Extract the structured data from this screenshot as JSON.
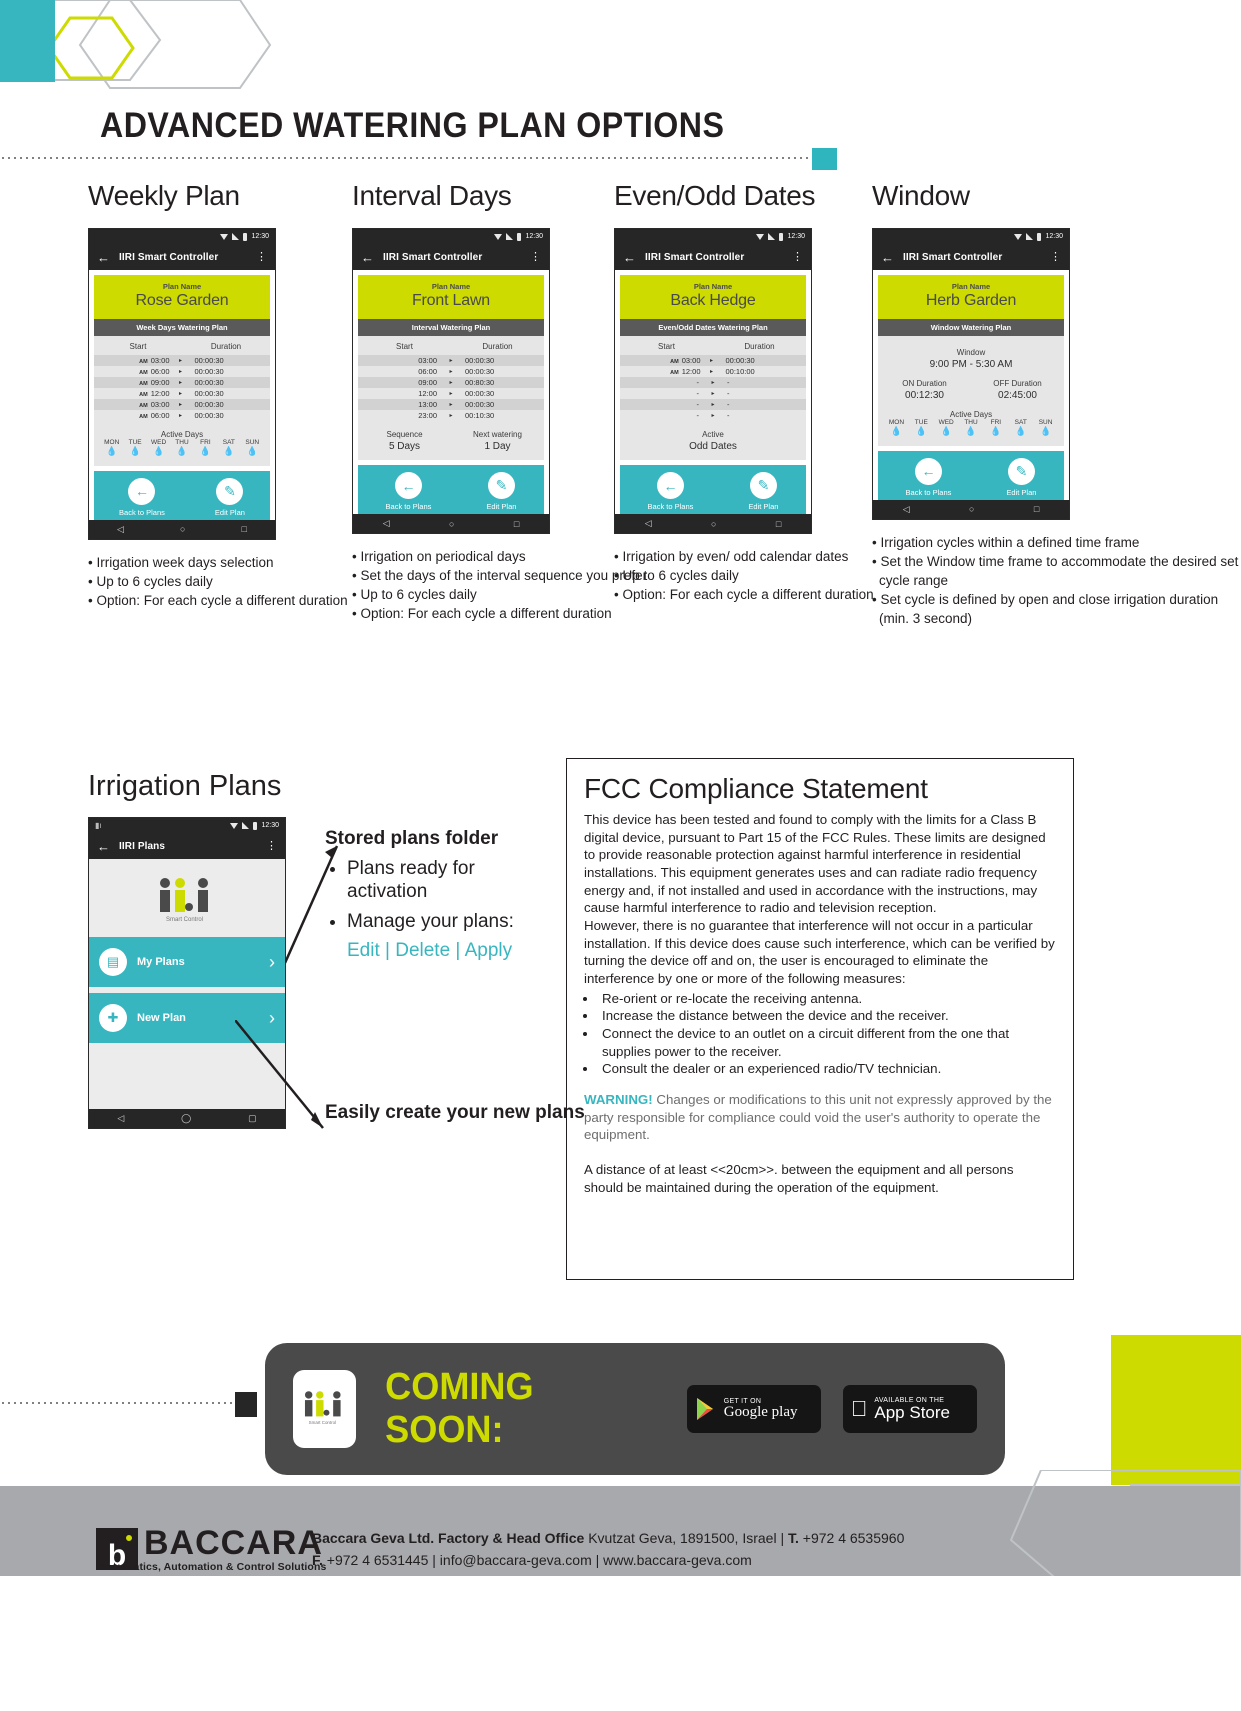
{
  "page": {
    "title": "ADVANCED WATERING PLAN OPTIONS",
    "accent_cyan": "#38b6c0",
    "accent_green": "#cddb00",
    "dark": "#262626"
  },
  "plans": [
    {
      "heading": "Weekly Plan",
      "status_time": "12:30",
      "app_title": "IIRI Smart Controller",
      "plan_name_label": "Plan Name",
      "plan_name": "Rose Garden",
      "plan_type": "Week Days Watering Plan",
      "col_start": "Start",
      "col_duration": "Duration",
      "rows": [
        {
          "ampm": "AM",
          "start": "03:00",
          "duration": "00:00:30"
        },
        {
          "ampm": "AM",
          "start": "06:00",
          "duration": "00:00:30"
        },
        {
          "ampm": "AM",
          "start": "09:00",
          "duration": "00:00:30"
        },
        {
          "ampm": "AM",
          "start": "12:00",
          "duration": "00:00:30"
        },
        {
          "ampm": "AM",
          "start": "03:00",
          "duration": "00:00:30"
        },
        {
          "ampm": "AM",
          "start": "06:00",
          "duration": "00:00:30"
        }
      ],
      "active_days_label": "Active Days",
      "day_names": [
        "MON",
        "TUE",
        "WED",
        "THU",
        "FRI",
        "SAT",
        "SUN"
      ],
      "day_states": [
        false,
        true,
        false,
        true,
        false,
        true,
        true
      ],
      "back_label": "Back to Plans",
      "edit_label": "Edit Plan",
      "bullets": [
        "Irrigation week days selection",
        "Up to 6 cycles daily",
        "Option: For each cycle a different duration"
      ]
    },
    {
      "heading": "Interval Days",
      "status_time": "12:30",
      "app_title": "IIRI Smart Controller",
      "plan_name_label": "Plan Name",
      "plan_name": "Front Lawn",
      "plan_type": "Interval Watering Plan",
      "col_start": "Start",
      "col_duration": "Duration",
      "rows": [
        {
          "ampm": "",
          "start": "03:00",
          "duration": "00:00:30"
        },
        {
          "ampm": "",
          "start": "06:00",
          "duration": "00:00:30"
        },
        {
          "ampm": "",
          "start": "09:00",
          "duration": "00:80:30"
        },
        {
          "ampm": "",
          "start": "12:00",
          "duration": "00:00:30"
        },
        {
          "ampm": "",
          "start": "13:00",
          "duration": "00:00:30"
        },
        {
          "ampm": "",
          "start": "23:00",
          "duration": "00:10:30"
        }
      ],
      "sequence_label": "Sequence",
      "sequence_value": "5 Days",
      "next_label": "Next watering",
      "next_value": "1 Day",
      "back_label": "Back to Plans",
      "edit_label": "Edit Plan",
      "bullets": [
        "Irrigation on periodical days",
        "Set the days of the interval sequence you prefer",
        "Up to 6 cycles daily",
        "Option: For each cycle a different duration"
      ]
    },
    {
      "heading": "Even/Odd Dates",
      "status_time": "12:30",
      "app_title": "IIRI Smart Controller",
      "plan_name_label": "Plan Name",
      "plan_name": "Back Hedge",
      "plan_type": "Even/Odd Dates Watering Plan",
      "col_start": "Start",
      "col_duration": "Duration",
      "rows": [
        {
          "ampm": "AM",
          "start": "03:00",
          "duration": "00:00:30"
        },
        {
          "ampm": "AM",
          "start": "12:00",
          "duration": "00:10:00"
        },
        {
          "ampm": "",
          "start": "-",
          "duration": "-"
        },
        {
          "ampm": "",
          "start": "-",
          "duration": "-"
        },
        {
          "ampm": "",
          "start": "-",
          "duration": "-"
        },
        {
          "ampm": "",
          "start": "-",
          "duration": "-"
        }
      ],
      "active_label": "Active",
      "active_value": "Odd Dates",
      "back_label": "Back to Plans",
      "edit_label": "Edit Plan",
      "bullets": [
        "Irrigation by even/ odd calendar dates",
        "Up to 6 cycles daily",
        "Option: For each cycle a different duration"
      ]
    },
    {
      "heading": "Window",
      "status_time": "12:30",
      "app_title": "IIRI Smart Controller",
      "plan_name_label": "Plan Name",
      "plan_name": "Herb Garden",
      "plan_type": "Window Watering Plan",
      "window_label": "Window",
      "window_value": "9:00 PM - 5:30 AM",
      "on_label": "ON Duration",
      "on_value": "00:12:30",
      "off_label": "OFF Duration",
      "off_value": "02:45:00",
      "active_days_label": "Active Days",
      "day_names": [
        "MON",
        "TUE",
        "WED",
        "THU",
        "FRI",
        "SAT",
        "SUN"
      ],
      "day_states": [
        false,
        true,
        false,
        true,
        false,
        true,
        false
      ],
      "back_label": "Back to Plans",
      "edit_label": "Edit Plan",
      "bullets": [
        "Irrigation cycles within a defined time frame",
        "Set the Window time frame to accommodate the desired set cycle range",
        "Set cycle is defined by open and close irrigation duration (min. 3 second)"
      ]
    }
  ],
  "irrigation_plans": {
    "heading": "Irrigation Plans",
    "status_time": "12:30",
    "app_title": "IIRI Plans",
    "logo_text": "ii.ri",
    "logo_sub": "Smart Control",
    "tiles": [
      {
        "label": "My Plans",
        "icon": "plan-folder-icon"
      },
      {
        "label": "New Plan",
        "icon": "new-plan-icon"
      }
    ],
    "callout_heading": "Stored plans folder",
    "callout_bullets": [
      "Plans ready for activation",
      "Manage your plans:"
    ],
    "callout_actions": "Edit | Delete | Apply",
    "easy_create": "Easily create your new plans"
  },
  "fcc": {
    "heading": "FCC Compliance Statement",
    "p1": "This device has been tested and found to comply with the limits for a Class B digital device, pursuant to Part 15 of the FCC Rules. These limits are designed to provide reasonable protection against harmful interference in residential installations. This equipment generates uses and can radiate radio frequency energy and, if not installed and used in accordance with the instructions, may cause harmful interference to radio and television reception.",
    "p2": "However, there is no guarantee that interference will not occur in a particular installation. If this device does cause such interference, which can be verified by turning the device off and on, the user is encouraged to eliminate the interference by one or more of the following measures:",
    "measures": [
      "Re-orient or re-locate the receiving antenna.",
      "Increase the distance between the device and the receiver.",
      "Connect the device to an outlet on a circuit different from the one that supplies power to the receiver.",
      "Consult the dealer or an experienced radio/TV technician."
    ],
    "warning_label": "WARNING!",
    "warning_text": " Changes or modifications to this unit not expressly approved by the party responsible for compliance could void the user's authority to operate the equipment.",
    "distance": "A distance of at least <<20cm>>. between the equipment  and all persons should be maintained during the operation of the equipment."
  },
  "coming_soon": {
    "text": "COMING SOON:",
    "logo_text": "ii.ri",
    "logo_sub": "Smart Control",
    "google_small": "GET IT ON",
    "google_big": "Google play",
    "apple_small": "AVAILABLE ON THE",
    "apple_big": "App Store"
  },
  "footer": {
    "brand": "BACCARA",
    "brand_sub": "Pneumatics, Automation & Control Solutions",
    "line1_bold": "Baccara Geva Ltd. Factory  & Head Office",
    "line1_rest": " Kvutzat Geva, 1891500, Israel | ",
    "line1_bold2": "T.",
    "line1_rest2": " +972 4 6535960",
    "line2_bold": "F.",
    "line2_rest": " +972 4 6531445 | info@baccara-geva.com | www.baccara-geva.com"
  }
}
